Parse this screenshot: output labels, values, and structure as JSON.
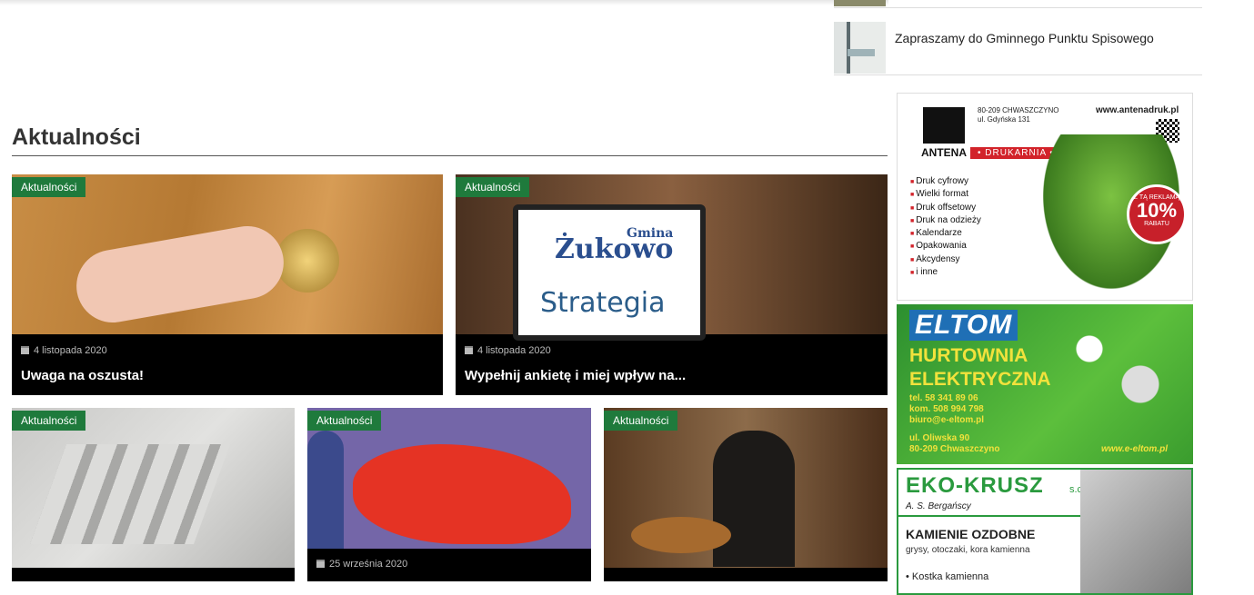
{
  "sidebar_list": {
    "items": [
      {
        "title": "Zapraszamy do Gminnego Punktu Spisowego"
      }
    ]
  },
  "section": {
    "title": "Aktualności"
  },
  "cards": [
    {
      "category": "Aktualności",
      "date": "4 listopada 2020",
      "title": "Uwaga na oszusta!"
    },
    {
      "category": "Aktualności",
      "date": "4 listopada 2020",
      "title": "Wypełnij ankietę i miej wpływ na..."
    },
    {
      "category": "Aktualności"
    },
    {
      "category": "Aktualności",
      "date": "25 września 2020"
    },
    {
      "category": "Aktualności"
    }
  ],
  "card_images": {
    "strategia": {
      "gmina": "Gmina",
      "name": "Żukowo",
      "word": "Strategia"
    }
  },
  "ads": {
    "antena": {
      "brand": "ANTENA",
      "label": "• DRUKARNIA •",
      "address_line1": "80-209 CHWASZCZYNO",
      "address_line2": "ul. Gdyńska 131",
      "website": "www.antenadruk.pl",
      "services": [
        "Druk cyfrowy",
        "Wielki format",
        "Druk offsetowy",
        "Druk na odzieży",
        "Kalendarze",
        "Opakowania",
        "Akcydensy",
        "i inne"
      ],
      "promo_top": "Z TĄ REKLAMĄ",
      "promo_value": "10%",
      "promo_bottom": "RABATU"
    },
    "eltom": {
      "brand": "ELTOM",
      "line1": "HURTOWNIA",
      "line2": "ELEKTRYCZNA",
      "phone": "tel. 58 341 89 06",
      "mobile": "kom. 508 994 798",
      "email": "biuro@e-eltom.pl",
      "street": "ul. Oliwska 90",
      "city": "80-209 Chwaszczyno",
      "website": "www.e-eltom.pl"
    },
    "eko": {
      "brand": "EKO-KRUSZ",
      "suffix": "s.c.",
      "owner": "A. S. Bergańscy",
      "headline": "KAMIENIE OZDOBNE",
      "subline": "grysy, otoczaki, kora kamienna",
      "item": "• Kostka kamienna"
    }
  },
  "colors": {
    "badge": "#1f7a3c",
    "card_bg": "#000000",
    "accent_red": "#d2232a"
  }
}
